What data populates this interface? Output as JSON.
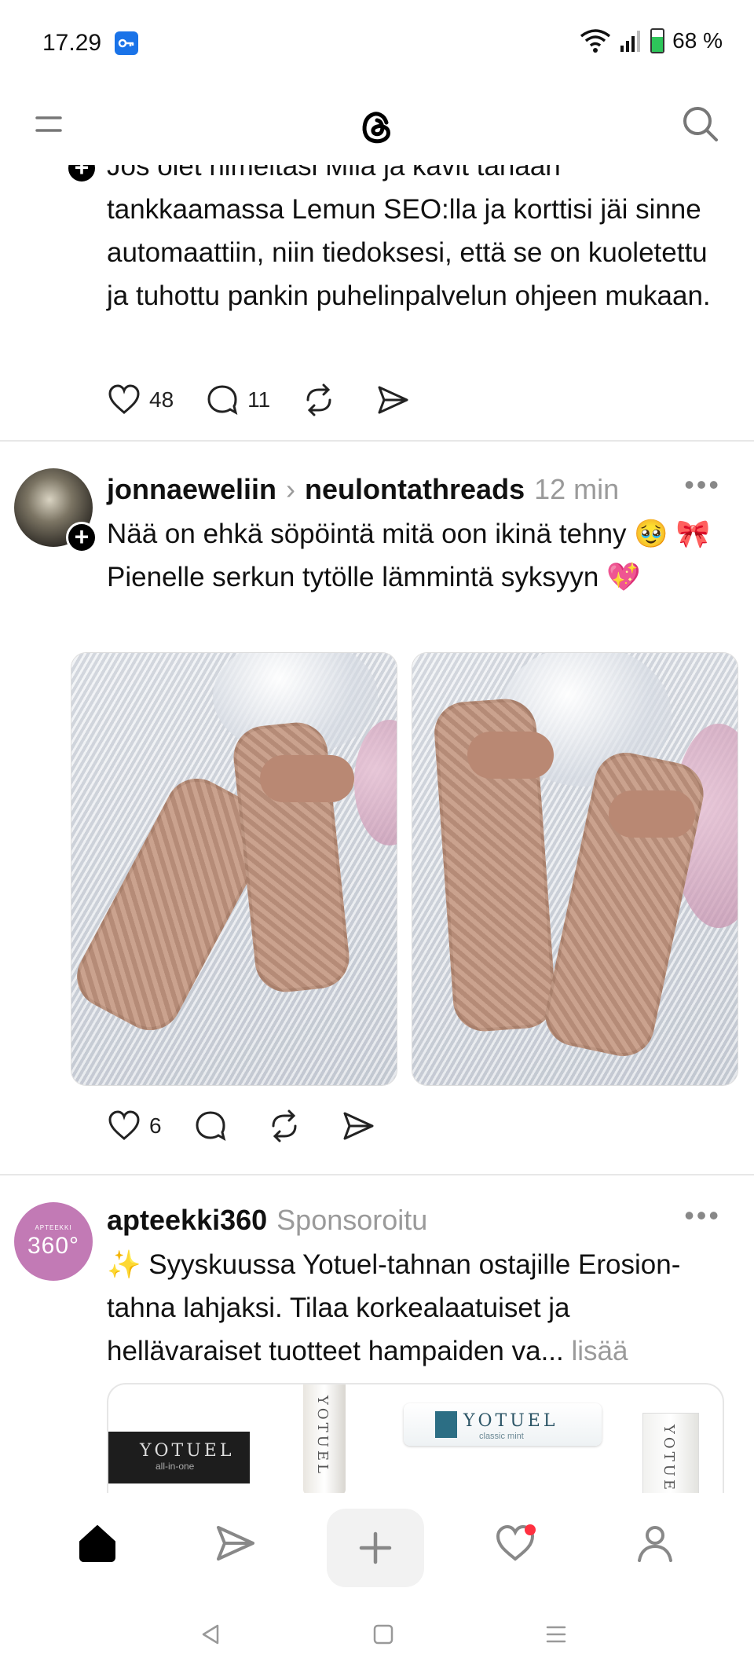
{
  "status_bar": {
    "time": "17.29",
    "battery": "68 %",
    "battery_level": 0.68
  },
  "header": {
    "logo": "threads-logo-icon"
  },
  "post1": {
    "text": "Jos olet nimeltäsi Miia ja kävit tänään tankkaamassa Lemun SEO:lla ja korttisi jäi sinne automaattiin, niin tiedoksesi, että se on kuoletettu ja tuhottu pankin puhelinpalvelun ohjeen mukaan.",
    "likes": "48",
    "replies": "11"
  },
  "post2": {
    "username": "jonnaeweliin",
    "community": "neulontathreads",
    "time": "12 min",
    "line1": "Nää on ehkä söpöintä mitä oon ikinä tehny 🥹 🎀",
    "line2": "Pienelle serkun tytölle lämmintä syksyyn 💖",
    "likes": "6"
  },
  "ad": {
    "username": "apteekki360",
    "label": "Sponsoroitu",
    "avatar_text": "360°",
    "avatar_small": "APTEEKKI",
    "text": "✨ Syyskuussa Yotuel-tahnan ostajille Erosion-tahna lahjaksi. Tilaa korkealaatuiset ja hellävaraiset tuotteet hampaiden va...",
    "more": "lisää",
    "products": [
      "YOTUEL",
      "YOTUEL",
      "YOTUEL",
      "YOTUEL"
    ],
    "product_sub": [
      "all-in-one",
      "classic mint"
    ]
  },
  "nav": {
    "items": [
      "home-icon",
      "send-icon",
      "compose-icon",
      "activity-icon",
      "profile-icon"
    ]
  }
}
